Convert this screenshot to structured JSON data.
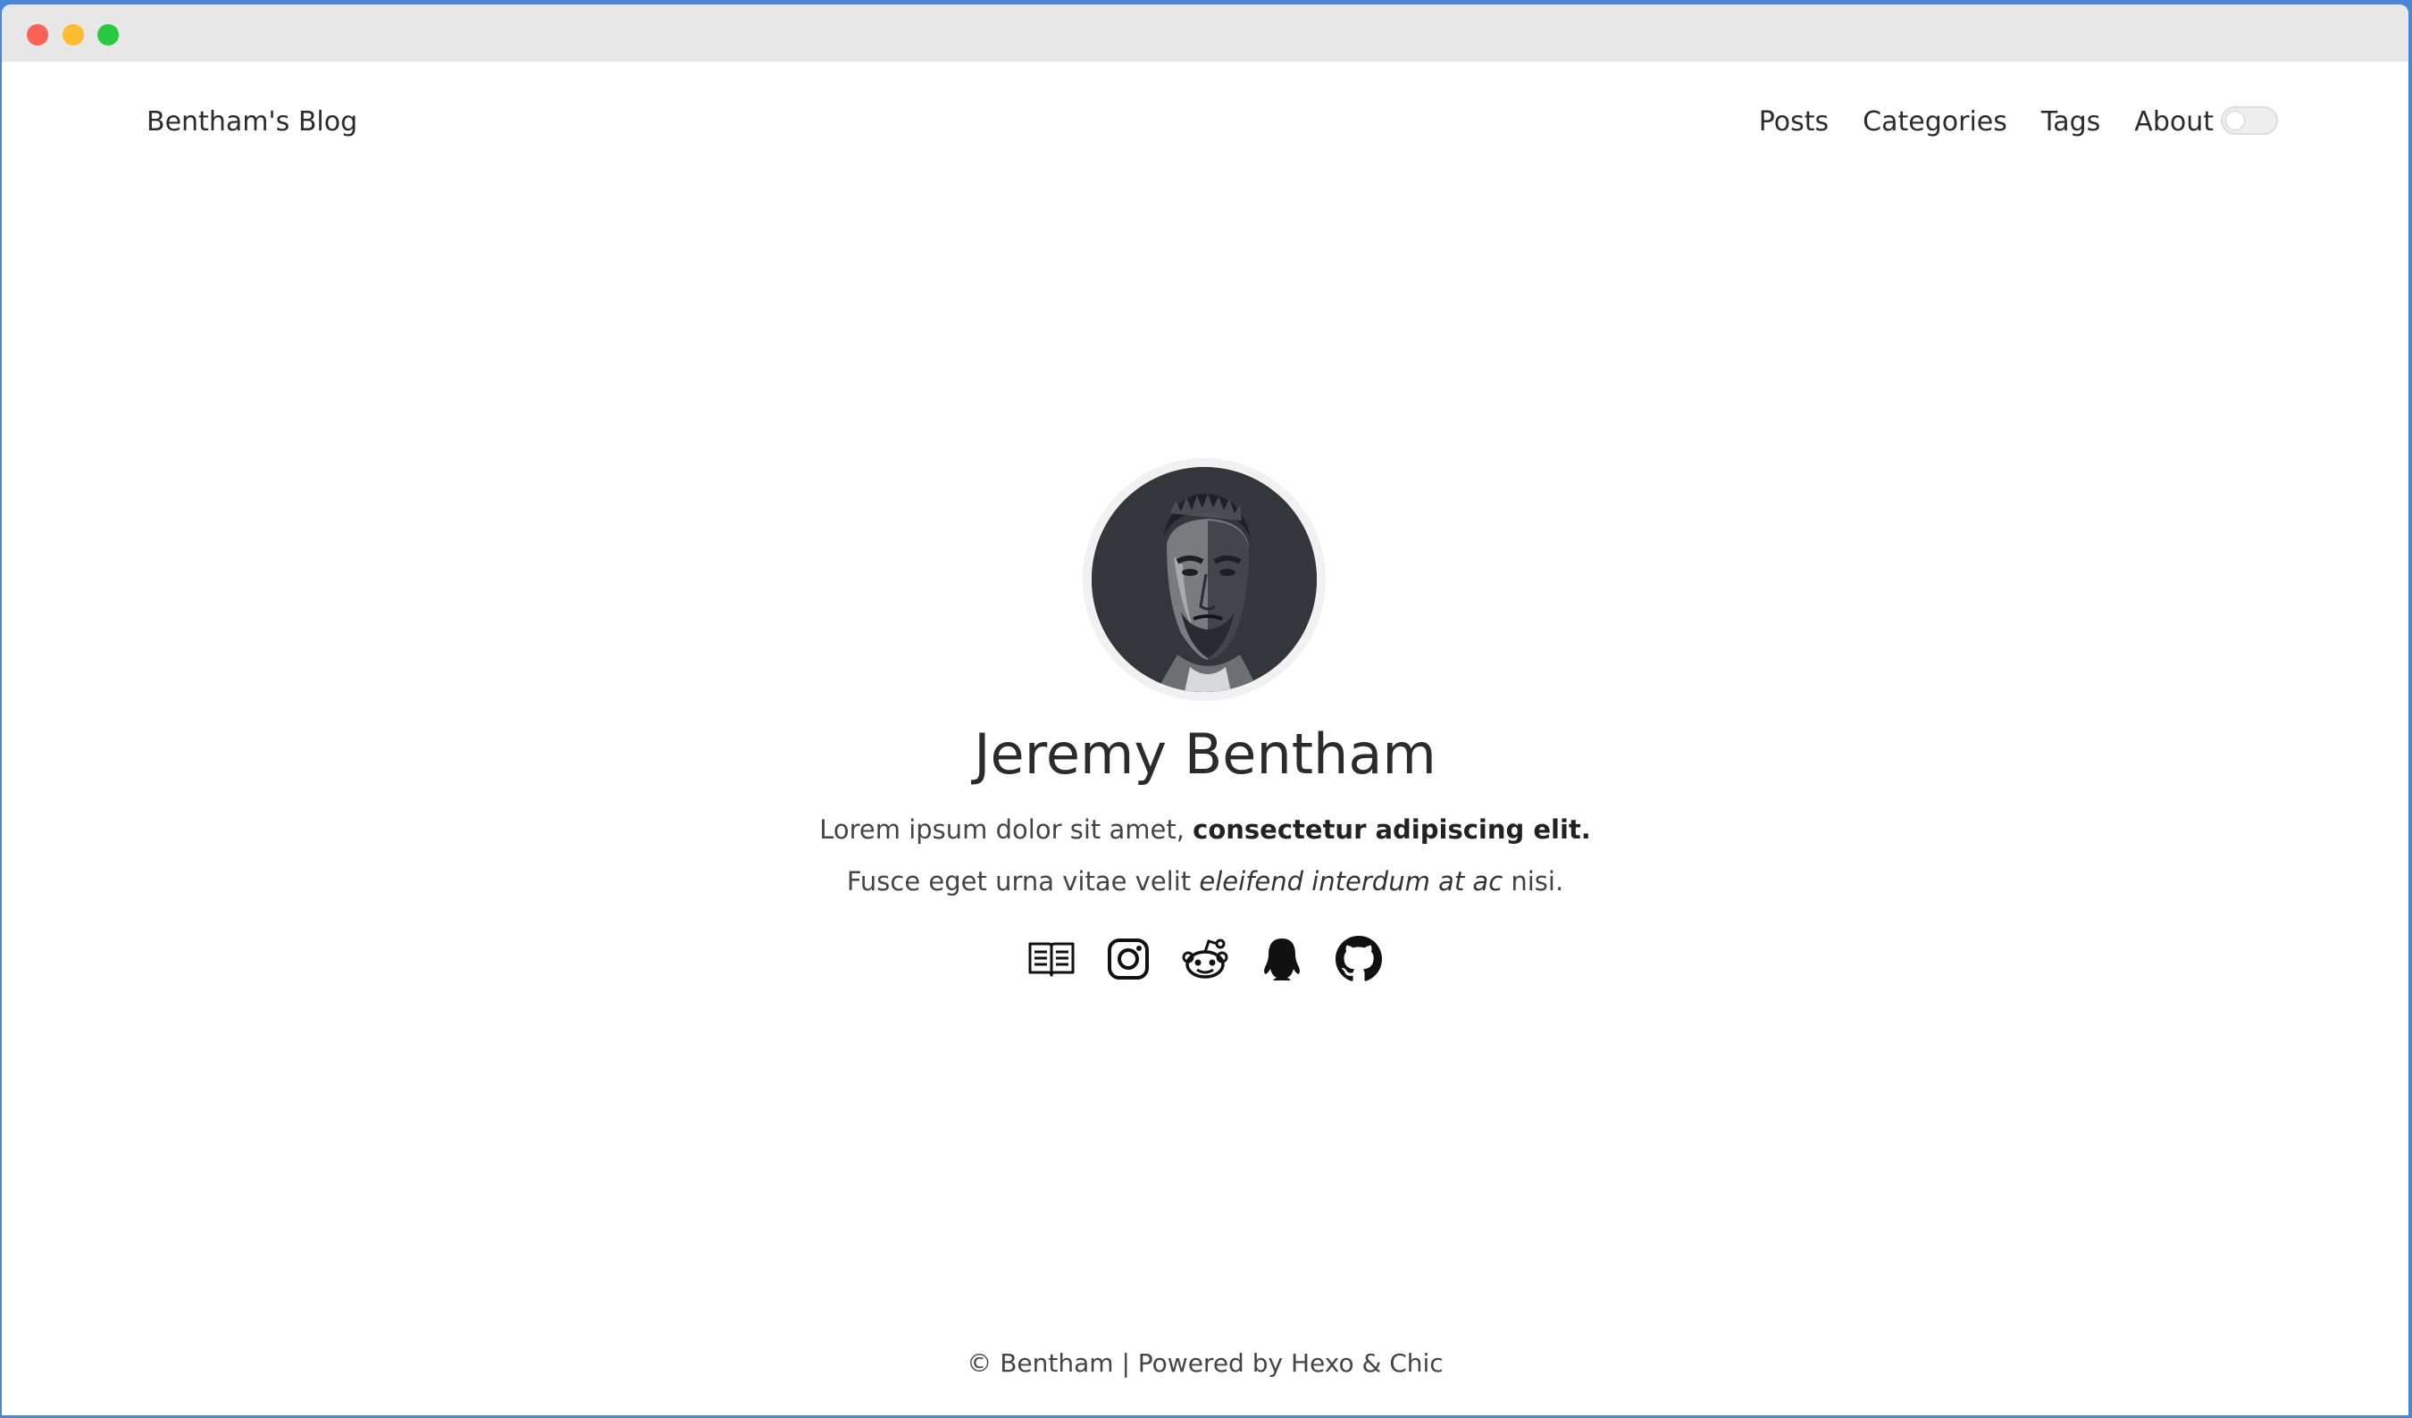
{
  "header": {
    "site_title": "Bentham's Blog",
    "nav": [
      {
        "label": "Posts"
      },
      {
        "label": "Categories"
      },
      {
        "label": "Tags"
      },
      {
        "label": "About"
      }
    ],
    "theme_toggle": {
      "icon": "toggle-switch",
      "state": "off"
    }
  },
  "profile": {
    "name": "Jeremy Bentham",
    "line1_plain": "Lorem ipsum dolor sit amet, ",
    "line1_bold": "consectetur adipiscing elit.",
    "line2_plain": "Fusce eget urna vitae velit ",
    "line2_italic": "eleifend interdum at ac",
    "line2_end": " nisi."
  },
  "socials": [
    {
      "icon": "book-icon"
    },
    {
      "icon": "instagram-icon"
    },
    {
      "icon": "reddit-icon"
    },
    {
      "icon": "qq-icon"
    },
    {
      "icon": "github-icon"
    }
  ],
  "footer": {
    "text": "© Bentham | Powered by Hexo & Chic"
  },
  "colors": {
    "text": "#2b2b2b",
    "titlebar": "#e7e7e8",
    "close": "#fe5f57",
    "minimize": "#febc2e",
    "maximize": "#28c840",
    "frame": "#4a86d6"
  }
}
